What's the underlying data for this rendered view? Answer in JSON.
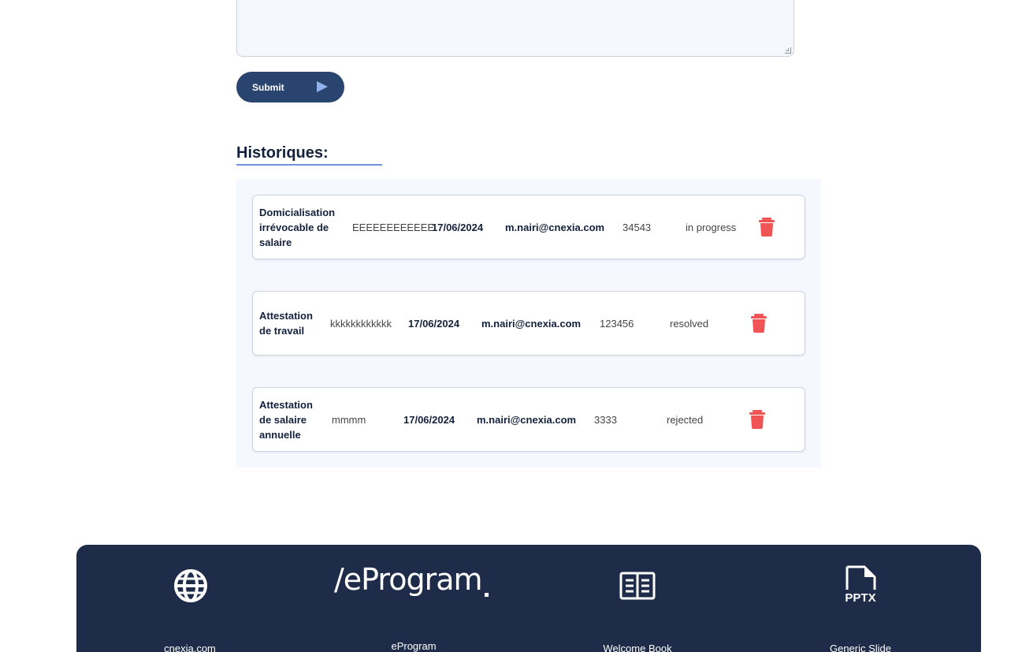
{
  "form": {
    "submit_label": "Submit"
  },
  "history": {
    "title": "Historiques:",
    "rows": [
      {
        "type": "Domicialisation irrévocable de salaire",
        "description": "EEEEEEEEEEEE",
        "date": "17/06/2024",
        "email": "m.nairi@cnexia.com",
        "number": "34543",
        "status": "in progress"
      },
      {
        "type": "Attestation de travail",
        "description": "kkkkkkkkkkkk",
        "date": "17/06/2024",
        "email": "m.nairi@cnexia.com",
        "number": "123456",
        "status": "resolved"
      },
      {
        "type": "Attestation de salaire annuelle",
        "description": "mmmm",
        "date": "17/06/2024",
        "email": "m.nairi@cnexia.com",
        "number": "3333",
        "status": "rejected"
      }
    ]
  },
  "footer": {
    "logo_text": "/eProgram",
    "items": [
      {
        "icon": "globe-icon",
        "label": "cnexia.com"
      },
      {
        "icon": "eprogram-logo",
        "label": "eProgram"
      },
      {
        "icon": "book-icon",
        "label": "Welcome Book"
      },
      {
        "icon": "pptx-file-icon",
        "icon_text": "PPTX",
        "label": "Generic Slide"
      }
    ]
  },
  "colors": {
    "primary": "#2a4470",
    "footer_bg": "#1e2c4a",
    "panel_bg": "#f5f8fe",
    "accent_underline": "#6f93d9",
    "delete": "#f05454"
  }
}
